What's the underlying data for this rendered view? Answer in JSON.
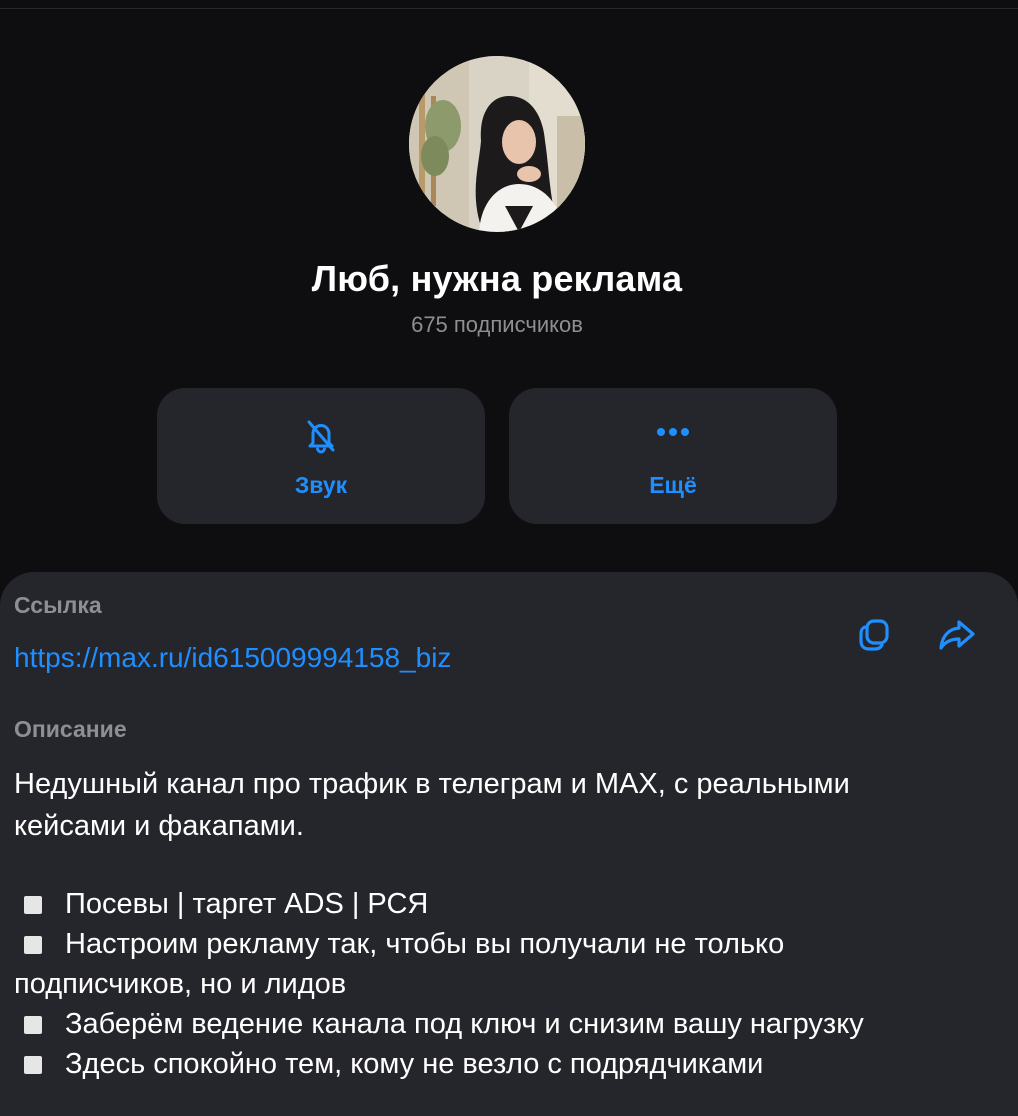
{
  "channel": {
    "name": "Люб, нужна реклама",
    "subscribers": "675 подписчиков"
  },
  "actions": {
    "sound_label": "Звук",
    "sound_icon": "bell-muted-icon",
    "more_label": "Ещё",
    "more_icon": "more-dots-icon"
  },
  "link_section": {
    "label": "Ссылка",
    "url": "https://max.ru/id615009994158_biz",
    "copy_icon": "copy-icon",
    "share_icon": "share-icon"
  },
  "description_section": {
    "label": "Описание",
    "intro_line1": "Недушный канал про трафик в телеграм и MAX, с реальными",
    "intro_line2": "кейсами и факапами.",
    "bullets": [
      "Посевы | таргет ADS | РСЯ",
      "Настроим рекламу так, чтобы вы получали не только",
      "Заберём ведение канала под ключ и снизим вашу нагрузку",
      "Здесь спокойно тем, кому не везло с подрядчиками"
    ],
    "bullet2_continuation": "подписчиков, но и лидов"
  },
  "colors": {
    "background": "#0e0e10",
    "card": "#25252c",
    "accent": "#1f8fff",
    "muted_text": "#8e8e93"
  }
}
